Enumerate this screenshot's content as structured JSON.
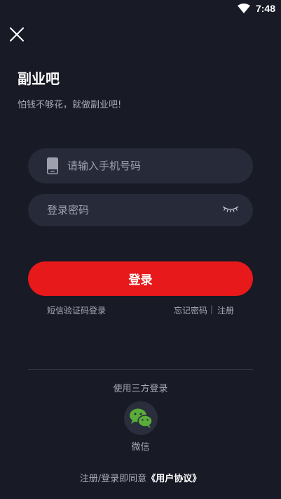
{
  "status_bar": {
    "time": "7:48",
    "wifi_icon": "wifi-icon"
  },
  "header": {
    "close_icon": "close-icon",
    "title": "副业吧",
    "slogan": "怕钱不够花，就做副业吧!"
  },
  "form": {
    "phone": {
      "placeholder": "请输入手机号码",
      "value": "",
      "icon": "phone-icon"
    },
    "password": {
      "placeholder": "登录密码",
      "value": "",
      "toggle_icon": "eye-closed-icon"
    },
    "login_label": "登录"
  },
  "links": {
    "sms_login": "短信验证码登录",
    "forgot_password": "忘记密码",
    "separator": "|",
    "register": "注册"
  },
  "third_party": {
    "label": "使用三方登录",
    "wechat_label": "微信",
    "wechat_icon": "wechat-icon"
  },
  "agreement": {
    "prefix": "注册/登录即同意",
    "link": "《用户协议》"
  },
  "colors": {
    "background": "#181a25",
    "field_background": "#262a39",
    "accent": "#e8191b",
    "muted_text": "#a8abb8",
    "wechat_green": "#5aac3a"
  }
}
